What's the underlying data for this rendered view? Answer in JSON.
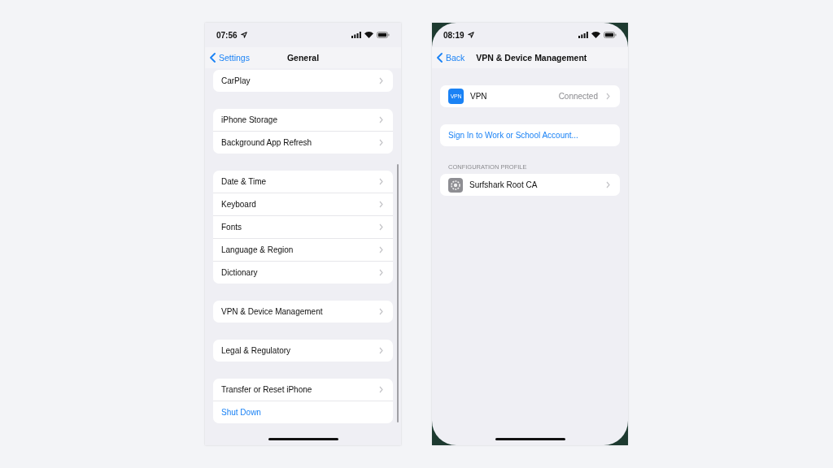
{
  "phones": [
    {
      "time": "07:56",
      "rounded_screen": false,
      "scrollbar": true,
      "nav": {
        "back": "Settings",
        "title": "General"
      },
      "groups": [
        {
          "rows": [
            {
              "kind": "item",
              "label": "CarPlay"
            }
          ]
        },
        {
          "rows": [
            {
              "kind": "item",
              "label": "iPhone Storage"
            },
            {
              "kind": "item",
              "label": "Background App Refresh"
            }
          ]
        },
        {
          "rows": [
            {
              "kind": "item",
              "label": "Date & Time"
            },
            {
              "kind": "item",
              "label": "Keyboard"
            },
            {
              "kind": "item",
              "label": "Fonts"
            },
            {
              "kind": "item",
              "label": "Language & Region"
            },
            {
              "kind": "item",
              "label": "Dictionary"
            }
          ]
        },
        {
          "rows": [
            {
              "kind": "item",
              "label": "VPN & Device Management"
            }
          ]
        },
        {
          "rows": [
            {
              "kind": "item",
              "label": "Legal & Regulatory"
            }
          ]
        },
        {
          "rows": [
            {
              "kind": "item",
              "label": "Transfer or Reset iPhone"
            },
            {
              "kind": "link",
              "label": "Shut Down"
            }
          ]
        }
      ]
    },
    {
      "time": "08:19",
      "rounded_screen": true,
      "scrollbar": false,
      "nav": {
        "back": "Back",
        "title": "VPN & Device Management"
      },
      "groups": [
        {
          "rows": [
            {
              "kind": "vpn",
              "icon_text": "VPN",
              "label": "VPN",
              "value": "Connected"
            }
          ]
        },
        {
          "rows": [
            {
              "kind": "link",
              "label": "Sign In to Work or School Account..."
            }
          ]
        },
        {
          "header": "CONFIGURATION PROFILE",
          "rows": [
            {
              "kind": "profile",
              "label": "Surfshark Root CA"
            }
          ]
        }
      ]
    }
  ]
}
